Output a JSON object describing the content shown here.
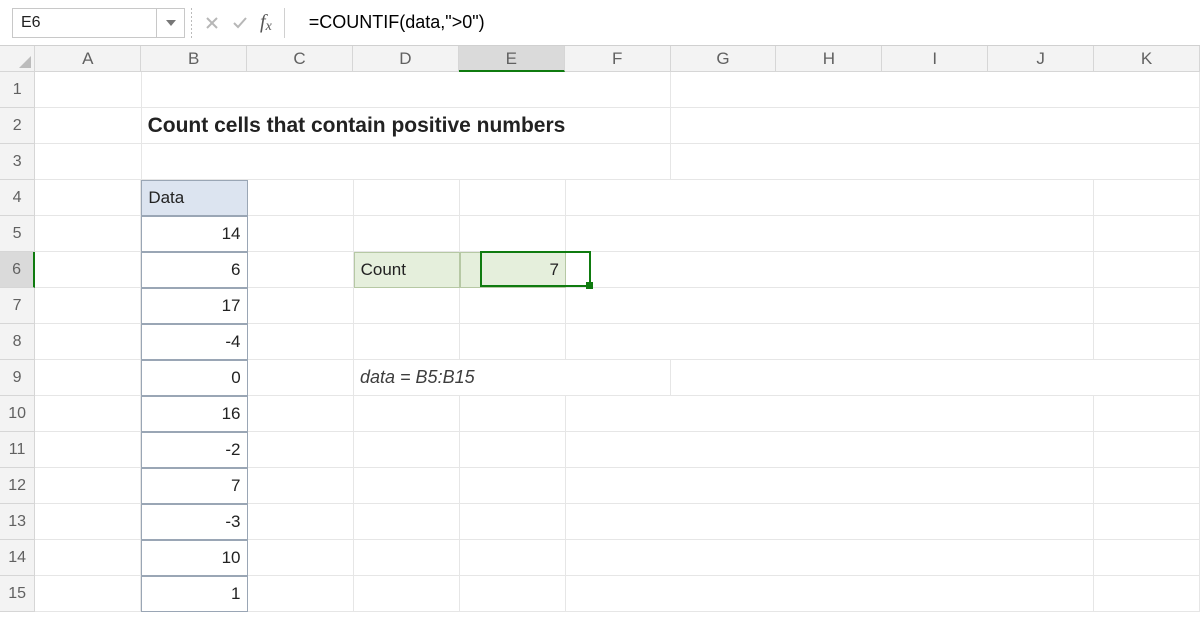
{
  "formula_bar": {
    "name_box": "E6",
    "formula": "=COUNTIF(data,\">0\")"
  },
  "columns": [
    "A",
    "B",
    "C",
    "D",
    "E",
    "F",
    "G",
    "H",
    "I",
    "J",
    "K"
  ],
  "rows": [
    "1",
    "2",
    "3",
    "4",
    "5",
    "6",
    "7",
    "8",
    "9",
    "10",
    "11",
    "12",
    "13",
    "14",
    "15"
  ],
  "title": "Count cells that contain positive numbers",
  "data_header": "Data",
  "data_values": [
    "14",
    "6",
    "17",
    "-4",
    "0",
    "16",
    "-2",
    "7",
    "-3",
    "10",
    "1"
  ],
  "count_label": "Count",
  "count_value": "7",
  "range_note": "data = B5:B15",
  "active": {
    "col": "E",
    "row": "6"
  },
  "icons": {
    "cancel": "cancel-icon",
    "confirm": "confirm-icon",
    "fx": "fx-icon",
    "dropdown": "chevron-down-icon"
  },
  "chart_data": {
    "type": "table",
    "title": "Count cells that contain positive numbers",
    "series": [
      {
        "name": "Data",
        "values": [
          14,
          6,
          17,
          -4,
          0,
          16,
          -2,
          7,
          -3,
          10,
          1
        ]
      }
    ],
    "computed": {
      "label": "Count",
      "value": 7,
      "formula": "=COUNTIF(data,\">0\")",
      "named_range": "data = B5:B15"
    }
  }
}
